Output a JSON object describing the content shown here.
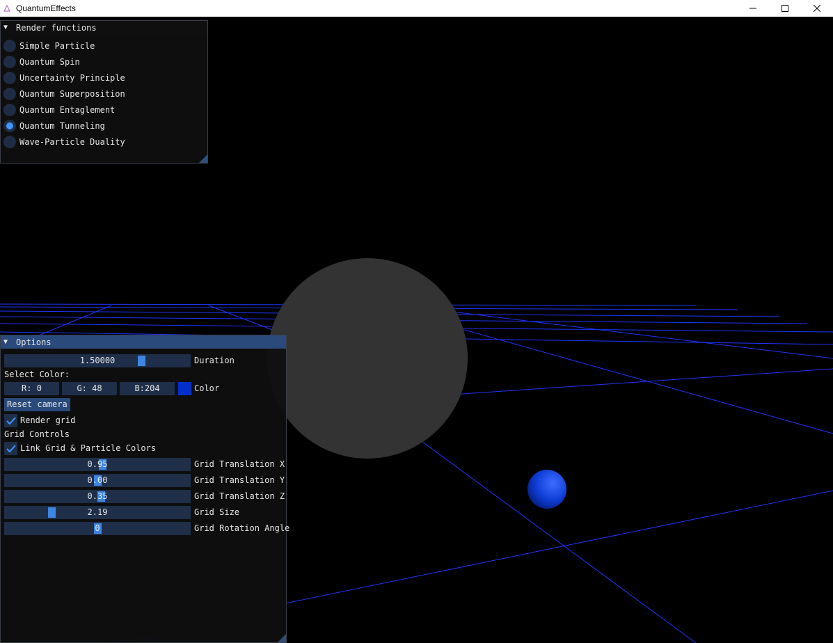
{
  "window": {
    "title": "QuantumEffects",
    "controls": [
      "minimize-icon",
      "maximize-icon",
      "close-icon"
    ]
  },
  "render_panel": {
    "title": "Render functions",
    "items": [
      {
        "label": "Simple Particle",
        "selected": false
      },
      {
        "label": "Quantum Spin",
        "selected": false
      },
      {
        "label": "Uncertainty Principle",
        "selected": false
      },
      {
        "label": "Quantum Superposition",
        "selected": false
      },
      {
        "label": "Quantum Entaglement",
        "selected": false
      },
      {
        "label": "Quantum Tunneling",
        "selected": true
      },
      {
        "label": "Wave-Particle Duality",
        "selected": false
      }
    ]
  },
  "options_panel": {
    "title": "Options",
    "duration": {
      "value": "1.50000",
      "label": "Duration",
      "fraction": 0.75
    },
    "select_color_label": "Select Color:",
    "color": {
      "r": "R:  0",
      "g": "G: 48",
      "b": "B:204",
      "label": "Color",
      "swatch": "#0030cc"
    },
    "reset_camera_label": "Reset camera",
    "render_grid": {
      "label": "Render grid",
      "checked": true
    },
    "grid_controls_label": "Grid Controls",
    "link_colors": {
      "label": "Link Grid & Particle Colors",
      "checked": true
    },
    "sliders": [
      {
        "value": "0.95",
        "label": "Grid Translation X",
        "fraction": 0.53
      },
      {
        "value": "0.00",
        "label": "Grid Translation Y",
        "fraction": 0.5
      },
      {
        "value": "0.35",
        "label": "Grid Translation Z",
        "fraction": 0.52
      },
      {
        "value": "2.19",
        "label": "Grid Size",
        "fraction": 0.24
      },
      {
        "value": "0",
        "label": "Grid Rotation Angle",
        "fraction": 0.5
      }
    ]
  },
  "colors": {
    "accent": "#4296fa",
    "grid": "#1f35ff",
    "big_sphere": "#333333",
    "particle": "#0030cc"
  }
}
